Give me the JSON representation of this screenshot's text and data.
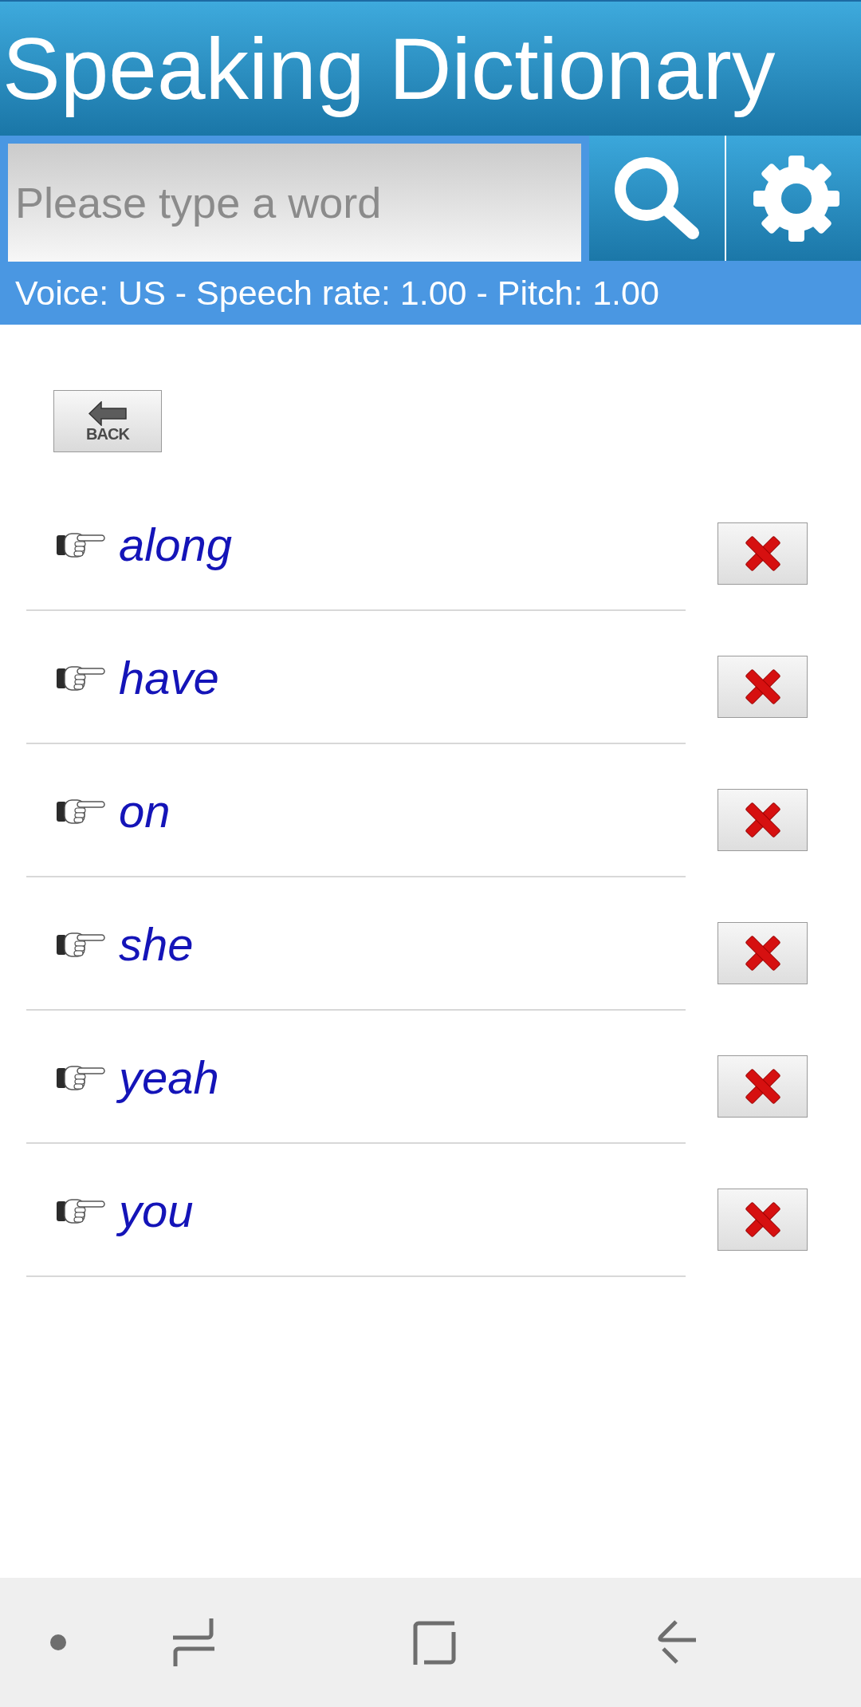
{
  "app_bar": {
    "title": "Speaking Dictionary"
  },
  "search": {
    "placeholder": "Please type a word"
  },
  "status_bar": {
    "text": "Voice: US - Speech rate: 1.00 - Pitch: 1.00"
  },
  "back_button": {
    "label": "BACK"
  },
  "words": [
    {
      "text": "along"
    },
    {
      "text": "have"
    },
    {
      "text": "on"
    },
    {
      "text": "she"
    },
    {
      "text": "yeah"
    },
    {
      "text": "you"
    }
  ]
}
